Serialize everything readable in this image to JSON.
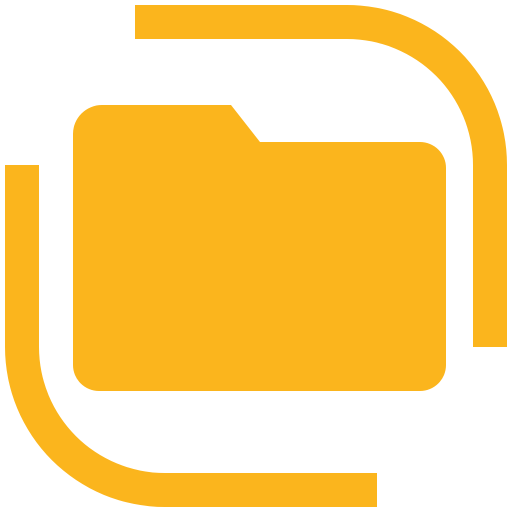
{
  "icon": {
    "name": "folder-app-icon",
    "color": "#FBB51D",
    "parts": [
      "folder-icon",
      "corner-bracket-top-right",
      "corner-bracket-bottom-left"
    ]
  }
}
